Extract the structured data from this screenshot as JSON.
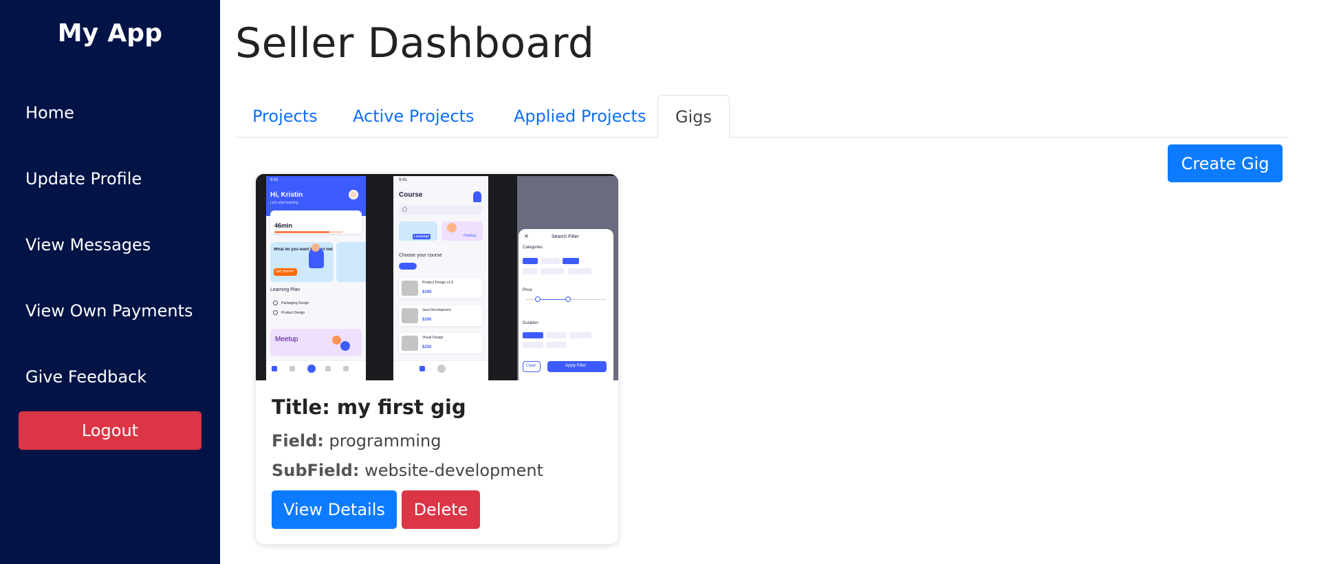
{
  "sidebar": {
    "brand": "My App",
    "items": [
      {
        "label": "Home"
      },
      {
        "label": "Update Profile"
      },
      {
        "label": "View Messages"
      },
      {
        "label": "View Own Payments"
      },
      {
        "label": "Give Feedback"
      }
    ],
    "logout_label": "Logout"
  },
  "main": {
    "title": "Seller Dashboard",
    "tabs": [
      {
        "label": "Projects"
      },
      {
        "label": "Active Projects"
      },
      {
        "label": "Applied Projects"
      },
      {
        "label": "Gigs",
        "active": true
      }
    ],
    "create_gig_label": "Create Gig",
    "gig": {
      "title": "Title: my first gig",
      "field_label": "Field:",
      "field_value": "programming",
      "subfield_label": "SubField:",
      "subfield_value": "website-development",
      "view_details_label": "View Details",
      "delete_label": "Delete",
      "image": {
        "greeting": "Hi, Kristin",
        "greeting_sub": "Let's start learning",
        "time_today": "46min",
        "promo": "What do you want to learn tod",
        "promo_btn": "Get Started",
        "plan_title": "Learning Plan",
        "plan_items": [
          "Packaging Design",
          "Product Design"
        ],
        "meetup": "Meetup",
        "course_title": "Course",
        "course_tags": [
          "Language",
          "Painting"
        ],
        "choose": "Choose your course",
        "courses": [
          "Product Design v1.0",
          "Java Development",
          "Visual Design"
        ],
        "prices": [
          "$190",
          "$190",
          "$250"
        ],
        "filter_title": "Search Filter",
        "filter_categories": "Categories",
        "filter_price": "Price",
        "filter_duration": "Duration",
        "filter_clear": "Clear",
        "filter_apply": "Apply Filter"
      }
    }
  },
  "colors": {
    "sidebar_bg": "#021346",
    "primary": "#0d7bff",
    "danger": "#dc3545",
    "mock_accent": "#3d5cff"
  }
}
